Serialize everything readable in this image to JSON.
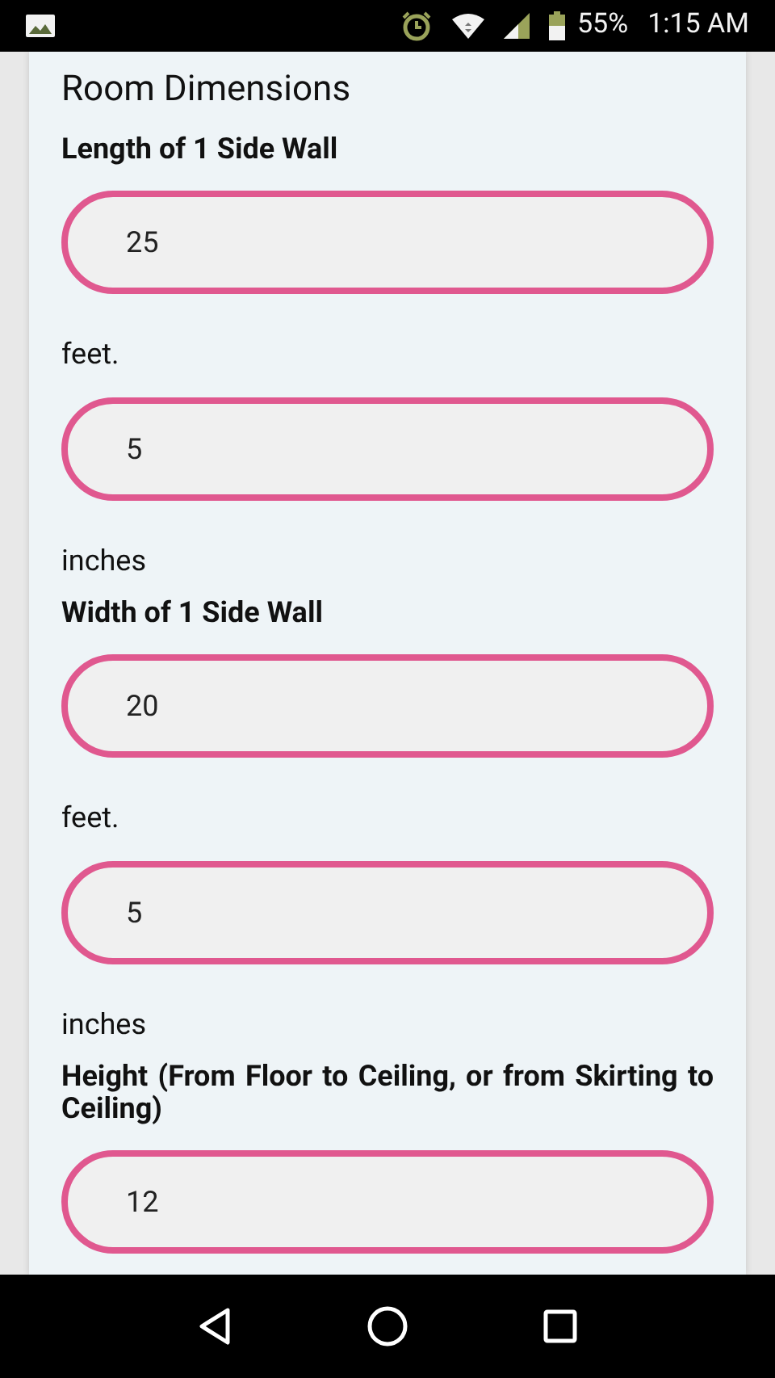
{
  "status_bar": {
    "battery": "55%",
    "time": "1:15 AM"
  },
  "heading": "Room Dimensions",
  "items": [
    {
      "kind": "label",
      "text": "Length of 1 Side Wall"
    },
    {
      "kind": "field",
      "value": "25"
    },
    {
      "kind": "unit",
      "text": "feet."
    },
    {
      "kind": "field",
      "value": "5"
    },
    {
      "kind": "unit",
      "text": "inches"
    },
    {
      "kind": "label",
      "text": "Width of 1 Side Wall"
    },
    {
      "kind": "field",
      "value": "20"
    },
    {
      "kind": "unit",
      "text": "feet."
    },
    {
      "kind": "field",
      "value": "5"
    },
    {
      "kind": "unit",
      "text": "inches"
    },
    {
      "kind": "label",
      "text": "Height (From Floor to Ceiling, or from Skirting to Ceiling)"
    },
    {
      "kind": "field",
      "value": "12"
    }
  ]
}
